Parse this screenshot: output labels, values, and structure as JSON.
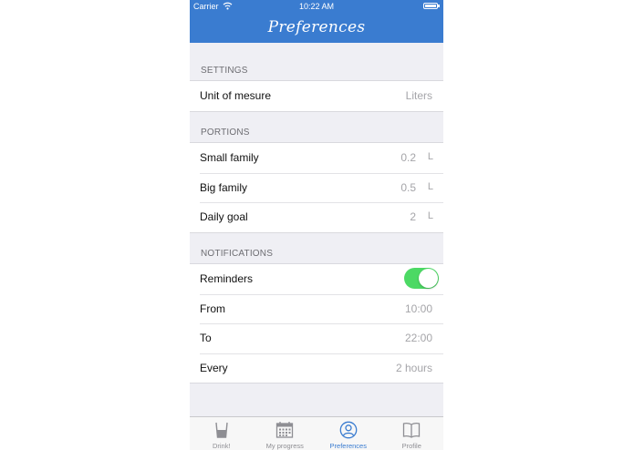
{
  "status_bar": {
    "carrier": "Carrier",
    "time": "10:22 AM"
  },
  "nav": {
    "title": "Preferences"
  },
  "settings": {
    "header": "SETTINGS",
    "unit": {
      "label": "Unit of mesure",
      "value": "Liters"
    }
  },
  "portions": {
    "header": "PORTIONS",
    "items": [
      {
        "label": "Small family",
        "value": "0.2",
        "unit": "L"
      },
      {
        "label": "Big family",
        "value": "0.5",
        "unit": "L"
      },
      {
        "label": "Daily goal",
        "value": "2",
        "unit": "L"
      }
    ]
  },
  "notifications": {
    "header": "NOTIFICATIONS",
    "reminders": {
      "label": "Reminders",
      "enabled": true
    },
    "from": {
      "label": "From",
      "value": "10:00"
    },
    "to": {
      "label": "To",
      "value": "22:00"
    },
    "every": {
      "label": "Every",
      "value": "2 hours"
    }
  },
  "tabs": [
    {
      "label": "Drink!",
      "icon": "glass-icon",
      "active": false
    },
    {
      "label": "My progress",
      "icon": "calendar-icon",
      "active": false
    },
    {
      "label": "Preferences",
      "icon": "user-icon",
      "active": true
    },
    {
      "label": "Profile",
      "icon": "book-icon",
      "active": false
    }
  ],
  "colors": {
    "accent": "#3a7cd0",
    "toggle_on": "#4cd964",
    "background": "#efeff4"
  }
}
